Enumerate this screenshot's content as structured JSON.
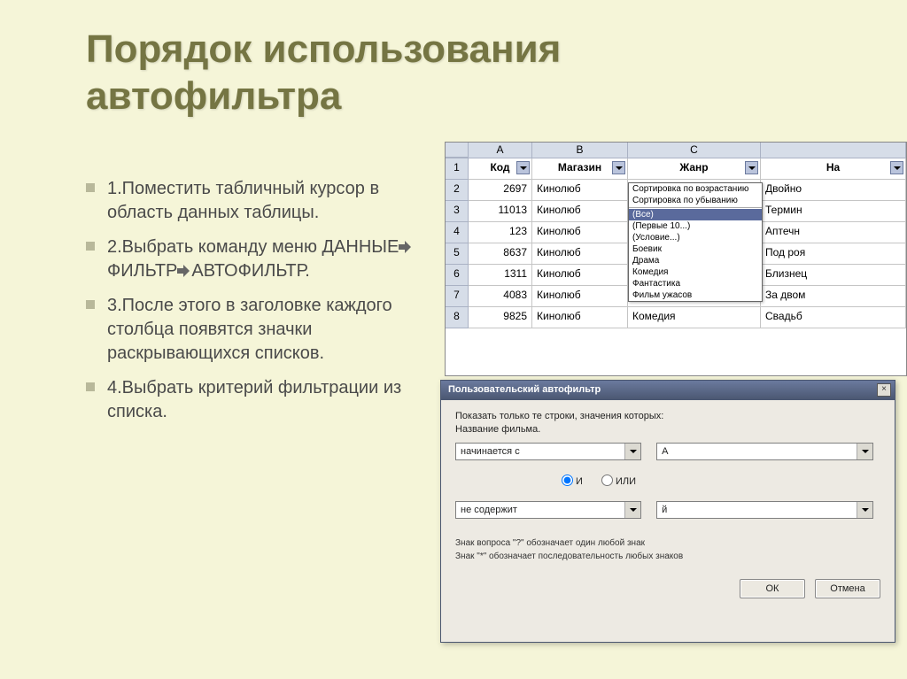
{
  "title": "Порядок использования автофильтра",
  "bullets": [
    "1.Поместить табличный курсор в область данных таблицы.",
    "2.Выбрать команду меню ДАННЫЕ⇨ФИЛЬТР⇨АВТОФИЛЬТР.",
    "3.После этого в заголовке каждого столбца появятся значки раскрывающихся списков.",
    "4.Выбрать критерий фильтрации из списка."
  ],
  "bullet2_parts": {
    "p1": "2.Выбрать команду меню ДАННЫЕ",
    "p2": "ФИЛЬТР",
    "p3": "АВТОФИЛЬТР."
  },
  "excel": {
    "col_labels": [
      "A",
      "B",
      "C"
    ],
    "headers": {
      "a": "Код",
      "b": "Магазин",
      "c": "Жанр",
      "d": "На"
    },
    "rows": [
      {
        "n": "2",
        "a": "2697",
        "b": "Кинолюб",
        "d": "Двойно"
      },
      {
        "n": "3",
        "a": "11013",
        "b": "Кинолюб",
        "d": "Термин"
      },
      {
        "n": "4",
        "a": "123",
        "b": "Кинолюб",
        "d": "Аптечн"
      },
      {
        "n": "5",
        "a": "8637",
        "b": "Кинолюб",
        "d": "Под роя"
      },
      {
        "n": "6",
        "a": "1311",
        "b": "Кинолюб",
        "d": "Близнец"
      },
      {
        "n": "7",
        "a": "4083",
        "b": "Кинолюб",
        "d": "За двом"
      },
      {
        "n": "8",
        "a": "9825",
        "b": "Кинолюб",
        "c": "Комедия",
        "d": "Свадьб"
      }
    ],
    "menu": {
      "sort_asc": "Сортировка по возрастанию",
      "sort_desc": "Сортировка по убыванию",
      "all": "(Все)",
      "top10": "(Первые 10...)",
      "custom": "(Условие...)",
      "opts": [
        "Боевик",
        "Драма",
        "Комедия",
        "Фантастика",
        "Фильм ужасов"
      ]
    }
  },
  "dialog": {
    "title": "Пользовательский автофильтр",
    "label": "Показать только те строки, значения которых:",
    "field": "Название фильма.",
    "cond1": "начинается с",
    "val1": "А",
    "r_and": "И",
    "r_or": "ИЛИ",
    "cond2": "не содержит",
    "val2": "й",
    "hint1": "Знак вопроса \"?\" обозначает один любой знак",
    "hint2": "Знак \"*\" обозначает последовательность любых знаков",
    "ok": "ОК",
    "cancel": "Отмена"
  }
}
